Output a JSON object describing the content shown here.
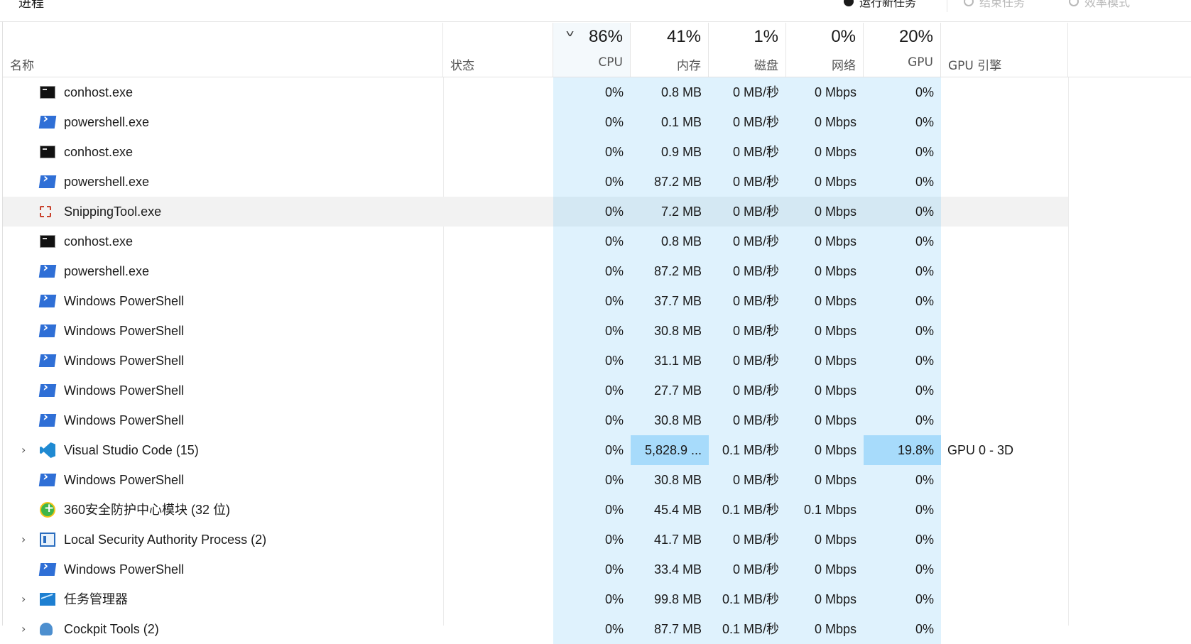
{
  "window": {
    "section_title": "进程",
    "run_task_label": "运行新任务",
    "end_task_label": "结束任务",
    "efficiency_label": "效率模式"
  },
  "columns": {
    "name": "名称",
    "status": "状态",
    "cpu": {
      "pct": "86%",
      "label": "CPU"
    },
    "mem": {
      "pct": "41%",
      "label": "内存"
    },
    "disk": {
      "pct": "1%",
      "label": "磁盘"
    },
    "net": {
      "pct": "0%",
      "label": "网络"
    },
    "gpu": {
      "pct": "20%",
      "label": "GPU"
    },
    "gpu_engine": "GPU 引擎"
  },
  "rows": [
    {
      "name": "conhost.exe",
      "icon": "console-icon",
      "expandable": false,
      "cpu": "0%",
      "mem": "0.8 MB",
      "disk": "0 MB/秒",
      "net": "0 Mbps",
      "gpu": "0%",
      "engine": ""
    },
    {
      "name": "powershell.exe",
      "icon": "powershell-icon",
      "expandable": false,
      "cpu": "0%",
      "mem": "0.1 MB",
      "disk": "0 MB/秒",
      "net": "0 Mbps",
      "gpu": "0%",
      "engine": ""
    },
    {
      "name": "conhost.exe",
      "icon": "console-icon",
      "expandable": false,
      "cpu": "0%",
      "mem": "0.9 MB",
      "disk": "0 MB/秒",
      "net": "0 Mbps",
      "gpu": "0%",
      "engine": ""
    },
    {
      "name": "powershell.exe",
      "icon": "powershell-icon",
      "expandable": false,
      "cpu": "0%",
      "mem": "87.2 MB",
      "disk": "0 MB/秒",
      "net": "0 Mbps",
      "gpu": "0%",
      "engine": ""
    },
    {
      "name": "SnippingTool.exe",
      "icon": "snipping-tool-icon",
      "expandable": false,
      "highlighted": true,
      "cpu": "0%",
      "mem": "7.2 MB",
      "disk": "0 MB/秒",
      "net": "0 Mbps",
      "gpu": "0%",
      "engine": ""
    },
    {
      "name": "conhost.exe",
      "icon": "console-icon",
      "expandable": false,
      "cpu": "0%",
      "mem": "0.8 MB",
      "disk": "0 MB/秒",
      "net": "0 Mbps",
      "gpu": "0%",
      "engine": ""
    },
    {
      "name": "powershell.exe",
      "icon": "powershell-icon",
      "expandable": false,
      "cpu": "0%",
      "mem": "87.2 MB",
      "disk": "0 MB/秒",
      "net": "0 Mbps",
      "gpu": "0%",
      "engine": ""
    },
    {
      "name": "Windows PowerShell",
      "icon": "powershell-icon",
      "expandable": false,
      "cpu": "0%",
      "mem": "37.7 MB",
      "disk": "0 MB/秒",
      "net": "0 Mbps",
      "gpu": "0%",
      "engine": ""
    },
    {
      "name": "Windows PowerShell",
      "icon": "powershell-icon",
      "expandable": false,
      "cpu": "0%",
      "mem": "30.8 MB",
      "disk": "0 MB/秒",
      "net": "0 Mbps",
      "gpu": "0%",
      "engine": ""
    },
    {
      "name": "Windows PowerShell",
      "icon": "powershell-icon",
      "expandable": false,
      "cpu": "0%",
      "mem": "31.1 MB",
      "disk": "0 MB/秒",
      "net": "0 Mbps",
      "gpu": "0%",
      "engine": ""
    },
    {
      "name": "Windows PowerShell",
      "icon": "powershell-icon",
      "expandable": false,
      "cpu": "0%",
      "mem": "27.7 MB",
      "disk": "0 MB/秒",
      "net": "0 Mbps",
      "gpu": "0%",
      "engine": ""
    },
    {
      "name": "Windows PowerShell",
      "icon": "powershell-icon",
      "expandable": false,
      "cpu": "0%",
      "mem": "30.8 MB",
      "disk": "0 MB/秒",
      "net": "0 Mbps",
      "gpu": "0%",
      "engine": ""
    },
    {
      "name": "Visual Studio Code (15)",
      "icon": "vscode-icon",
      "expandable": true,
      "mem_hot": true,
      "gpu_hot": true,
      "cpu": "0%",
      "mem": "5,828.9 ...",
      "disk": "0.1 MB/秒",
      "net": "0 Mbps",
      "gpu": "19.8%",
      "engine": "GPU 0 - 3D"
    },
    {
      "name": "Windows PowerShell",
      "icon": "powershell-icon",
      "expandable": false,
      "cpu": "0%",
      "mem": "30.8 MB",
      "disk": "0 MB/秒",
      "net": "0 Mbps",
      "gpu": "0%",
      "engine": ""
    },
    {
      "name": "360安全防护中心模块 (32 位)",
      "icon": "360-security-icon",
      "expandable": false,
      "cpu": "0%",
      "mem": "45.4 MB",
      "disk": "0.1 MB/秒",
      "net": "0.1 Mbps",
      "gpu": "0%",
      "engine": ""
    },
    {
      "name": "Local Security Authority Process (2)",
      "icon": "lsa-icon",
      "expandable": true,
      "cpu": "0%",
      "mem": "41.7 MB",
      "disk": "0 MB/秒",
      "net": "0 Mbps",
      "gpu": "0%",
      "engine": ""
    },
    {
      "name": "Windows PowerShell",
      "icon": "powershell-icon",
      "expandable": false,
      "cpu": "0%",
      "mem": "33.4 MB",
      "disk": "0 MB/秒",
      "net": "0 Mbps",
      "gpu": "0%",
      "engine": ""
    },
    {
      "name": "任务管理器",
      "icon": "task-manager-icon",
      "expandable": true,
      "cpu": "0%",
      "mem": "99.8 MB",
      "disk": "0.1 MB/秒",
      "net": "0 Mbps",
      "gpu": "0%",
      "engine": ""
    },
    {
      "name": "Cockpit Tools (2)",
      "icon": "cockpit-tools-icon",
      "expandable": true,
      "cpu": "0%",
      "mem": "87.7 MB",
      "disk": "0.1 MB/秒",
      "net": "0 Mbps",
      "gpu": "0%",
      "engine": ""
    }
  ]
}
